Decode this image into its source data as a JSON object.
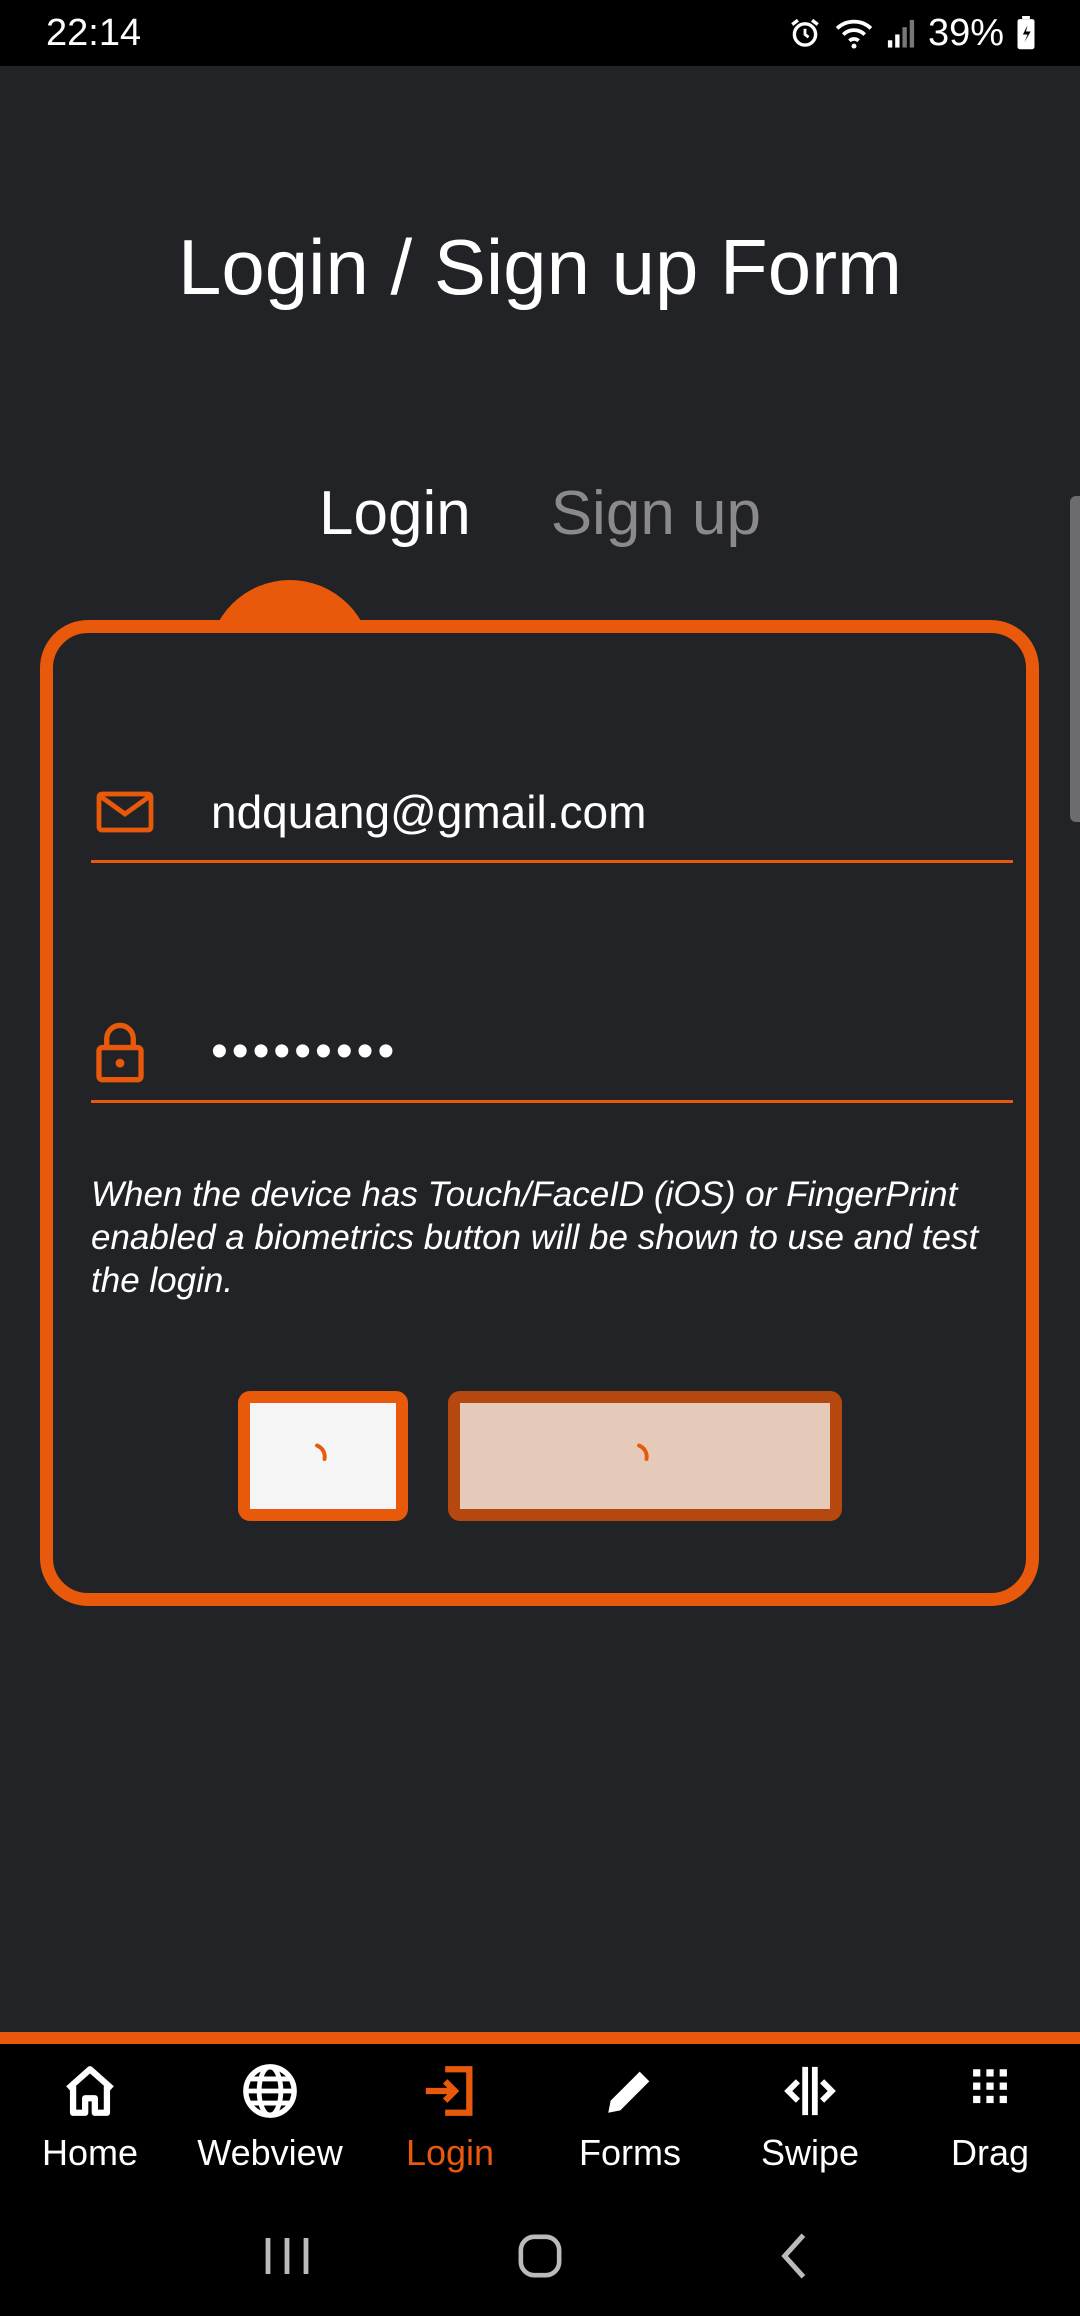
{
  "status_bar": {
    "time": "22:14",
    "battery": "39%",
    "icons": [
      "alarm-icon",
      "wifi-icon",
      "signal-icon",
      "battery-charging-icon"
    ]
  },
  "page": {
    "title": "Login / Sign up Form"
  },
  "tabs": {
    "login": "Login",
    "signup": "Sign up",
    "active": "login"
  },
  "form": {
    "email_value": "ndquang@gmail.com",
    "password_value": "•••••••••",
    "helper_text": "When the device has Touch/FaceID (iOS) or FingerPrint enabled a biometrics button will be shown to use and test the login."
  },
  "bottom_nav": {
    "items": [
      {
        "label": "Home",
        "icon": "home-icon"
      },
      {
        "label": "Webview",
        "icon": "globe-icon"
      },
      {
        "label": "Login",
        "icon": "login-icon"
      },
      {
        "label": "Forms",
        "icon": "pencil-icon"
      },
      {
        "label": "Swipe",
        "icon": "swipe-icon"
      },
      {
        "label": "Drag",
        "icon": "grid-dots-icon"
      }
    ],
    "active": "Login"
  },
  "colors": {
    "accent": "#e8590c",
    "background": "#222326",
    "login_button_bg": "#e6cab9"
  }
}
